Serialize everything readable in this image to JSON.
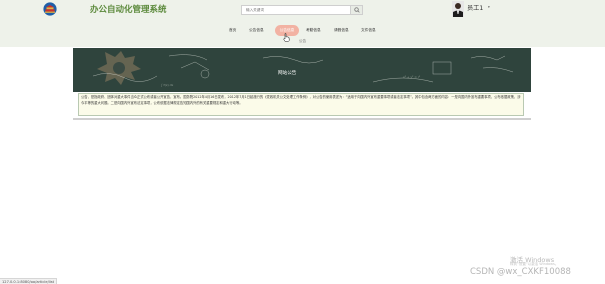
{
  "header": {
    "app_title": "办公自动化管理系统",
    "search_placeholder": "输入关键词",
    "user_name": "员工1",
    "user_caret": "▾"
  },
  "nav": {
    "items": [
      "首页",
      "公告信息",
      "公告信息",
      "考勤信息",
      "请假信息",
      "文件信息"
    ],
    "active_index": 2
  },
  "breadcrumb": "公告",
  "banner": {
    "title": "网站公告"
  },
  "content": {
    "text": "公告，是指政府、团体对重大事件当众正式公布或者公开宣告，宣布。国务院2012年4月16日发布，2012年7月1日起施行的《党政机关公文处理工作条例》，对公告的使用表述为：“适用于向国内外宣布重要事项或者法定事项”。其中包含两方面的内容：一是向国内外宣布重要事项，公布依据政策，涉今平等的重大问题。二是向国内外宣布法定事项，公布依据法律规定告知国内外的有关重要规定和重大行动等。"
  },
  "status_bar": {
    "url": "127.0.0.1:8080/oa/article/list"
  },
  "overlay": {
    "activate_title": "激活 Windows",
    "activate_sub": "转到“设置”以激活 Windows。",
    "watermark": "CSDN @wx_CXKF10088"
  },
  "colors": {
    "header_bg": "#eef2ea",
    "title_green": "#5c8a3c",
    "nav_active_bg": "#f2b2a3",
    "banner_bg": "#2f443d",
    "content_bg": "#fbfbe9"
  },
  "icons": {
    "logo": "tiananmen-emblem-icon",
    "search": "search-icon",
    "avatar": "user-avatar-icon",
    "cursor": "hand-cursor-icon"
  }
}
